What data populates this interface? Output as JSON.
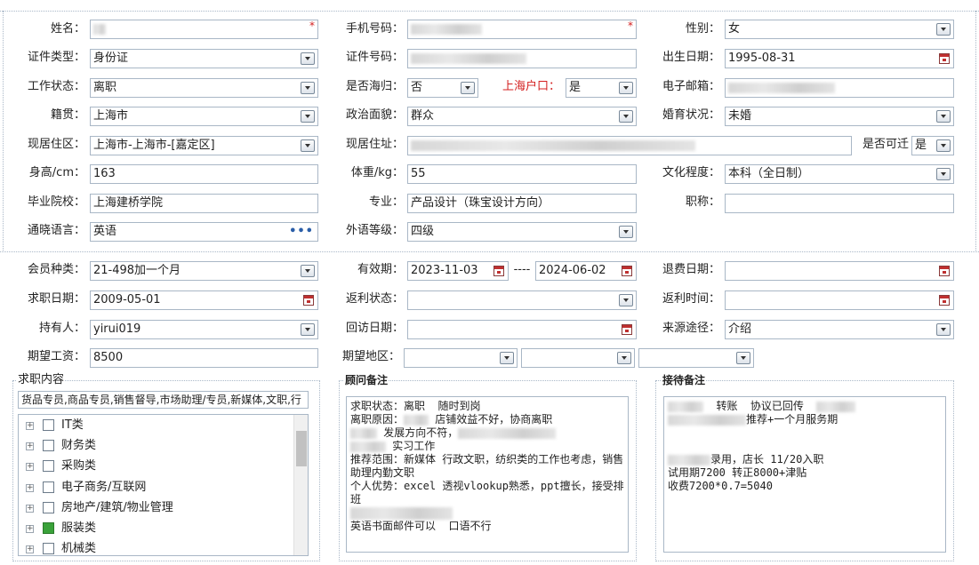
{
  "fields": {
    "name": {
      "label": "姓名："
    },
    "mobile": {
      "label": "手机号码："
    },
    "gender": {
      "label": "性别：",
      "value": "女"
    },
    "id_type": {
      "label": "证件类型：",
      "value": "身份证"
    },
    "id_number": {
      "label": "证件号码："
    },
    "birth_date": {
      "label": "出生日期：",
      "value": "1995-08-31"
    },
    "work_status": {
      "label": "工作状态：",
      "value": "离职"
    },
    "returnee": {
      "label": "是否海归：",
      "value": "否"
    },
    "shanghai_hukou": {
      "label": "上海户口：",
      "value": "是"
    },
    "email": {
      "label": "电子邮箱："
    },
    "native_place": {
      "label": "籍贯：",
      "value": "上海市"
    },
    "political": {
      "label": "政治面貌：",
      "value": "群众"
    },
    "marital": {
      "label": "婚育状况：",
      "value": "未婚"
    },
    "current_area": {
      "label": "现居住区：",
      "value": "上海市-上海市-[嘉定区]"
    },
    "current_address": {
      "label": "现居住址："
    },
    "relocatable": {
      "label": "是否可迁",
      "value": "是"
    },
    "height": {
      "label": "身高/cm：",
      "value": "163"
    },
    "weight": {
      "label": "体重/kg：",
      "value": "55"
    },
    "education": {
      "label": "文化程度：",
      "value": "本科（全日制）"
    },
    "school": {
      "label": "毕业院校：",
      "value": "上海建桥学院"
    },
    "major": {
      "label": "专业：",
      "value": "产品设计（珠宝设计方向）"
    },
    "title": {
      "label": "职称：",
      "value": ""
    },
    "language": {
      "label": "通晓语言：",
      "value": "英语"
    },
    "language_level": {
      "label": "外语等级：",
      "value": "四级"
    },
    "member_type": {
      "label": "会员种类：",
      "value": "21-498加一个月"
    },
    "validity": {
      "label": "有效期：",
      "start": "2023-11-03",
      "sep": "----",
      "end": "2024-06-02"
    },
    "refund_date": {
      "label": "退费日期：",
      "value": ""
    },
    "job_date": {
      "label": "求职日期：",
      "value": "2009-05-01"
    },
    "rebate_status": {
      "label": "返利状态：",
      "value": ""
    },
    "rebate_time": {
      "label": "返利时间：",
      "value": ""
    },
    "holder": {
      "label": "持有人：",
      "value": "yirui019"
    },
    "visit_date": {
      "label": "回访日期：",
      "value": ""
    },
    "source": {
      "label": "来源途径：",
      "value": "介绍"
    },
    "expected_salary": {
      "label": "期望工资：",
      "value": "8500"
    },
    "expected_area": {
      "label": "期望地区："
    }
  },
  "job_content": {
    "title": "求职内容",
    "summary": "货品专员,商品专员,销售督导,市场助理/专员,新媒体,文职,行",
    "categories": [
      {
        "label": "IT类",
        "checked": false
      },
      {
        "label": "财务类",
        "checked": false
      },
      {
        "label": "采购类",
        "checked": false
      },
      {
        "label": "电子商务/互联网",
        "checked": false
      },
      {
        "label": "房地产/建筑/物业管理",
        "checked": false
      },
      {
        "label": "服装类",
        "checked": true
      },
      {
        "label": "机械类",
        "checked": false
      }
    ]
  },
  "advisor_notes": {
    "title": "顾问备注",
    "lines": [
      "求职状态：离职  随时到岗",
      "离职原因：",
      "店铺效益不好，协商离职",
      "发展方向不符，",
      "实习工作",
      "推荐范围：新媒体 行政文职，纺织类的工作也考虑，销售助理内勤文职",
      "个人优势：excel 透视vlookup熟悉，ppt擅长，接受排班",
      "英语书面邮件可以  口语不行"
    ]
  },
  "reception_notes": {
    "title": "接待备注",
    "lines": [
      "转账  协议已回传",
      "推荐+一个月服务期",
      "录用，店长 11/20入职",
      "试用期7200 转正8000+津贴",
      "收费7200*0.7=5040"
    ]
  },
  "colors": {
    "accent_red": "#d42020",
    "border": "#a9b7c6",
    "checked_green": "#3aa23a"
  }
}
